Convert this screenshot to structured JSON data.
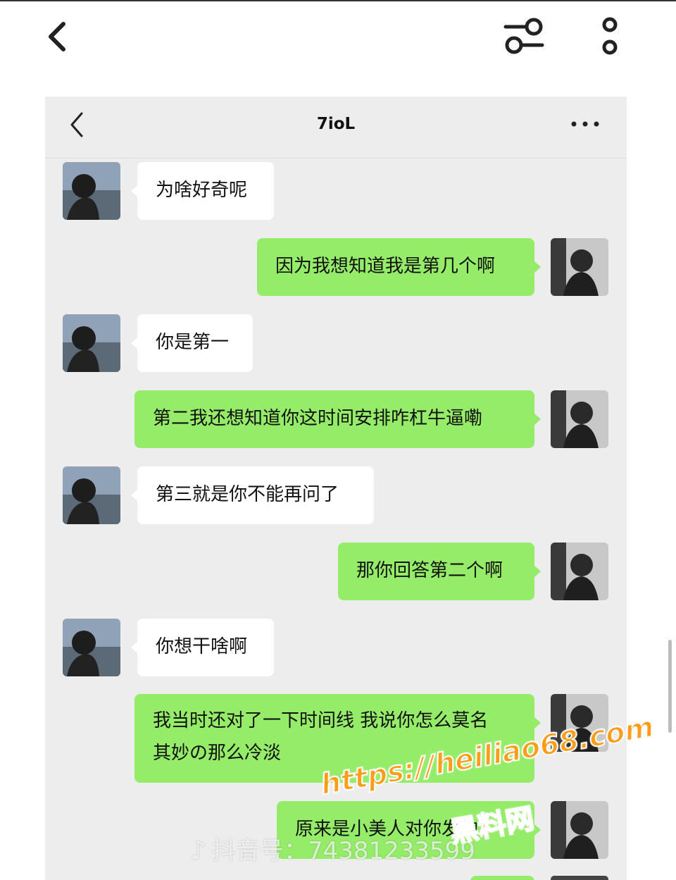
{
  "outer_toolbar": {
    "back_icon": "chevron-left-icon",
    "filter_icon": "sliders-icon",
    "more_icon": "more-vertical-icon"
  },
  "chat": {
    "title": "7ioL",
    "back_icon": "chevron-left-icon",
    "more_icon": "more-horizontal-icon",
    "messages": [
      {
        "side": "left",
        "lines": [
          "为啥好奇呢"
        ]
      },
      {
        "side": "right",
        "lines": [
          "因为我想知道我是第几个啊"
        ]
      },
      {
        "side": "left",
        "lines": [
          "你是第一"
        ]
      },
      {
        "side": "right",
        "lines": [
          "第二我还想知道你这时间安排咋杠牛逼嘞"
        ]
      },
      {
        "side": "left",
        "lines": [
          "第三就是你不能再问了"
        ]
      },
      {
        "side": "right",
        "lines": [
          "那你回答第二个啊"
        ]
      },
      {
        "side": "left",
        "lines": [
          "你想干啥啊"
        ]
      },
      {
        "side": "right",
        "lines": [
          "我当时还对了一下时间线 我说你怎么莫名",
          "其妙の那么冷淡"
        ]
      },
      {
        "side": "right",
        "lines": [
          "原来是小美人对你发钓"
        ]
      }
    ]
  },
  "watermarks": {
    "url": "https://heiliao68.com",
    "site": "黑料网",
    "douyin": "抖音号：74381233599"
  },
  "colors": {
    "bubble_green": "#95ec69",
    "bubble_white": "#ffffff",
    "chat_background": "#ededed",
    "watermark_orange": "#ff9d1a"
  }
}
